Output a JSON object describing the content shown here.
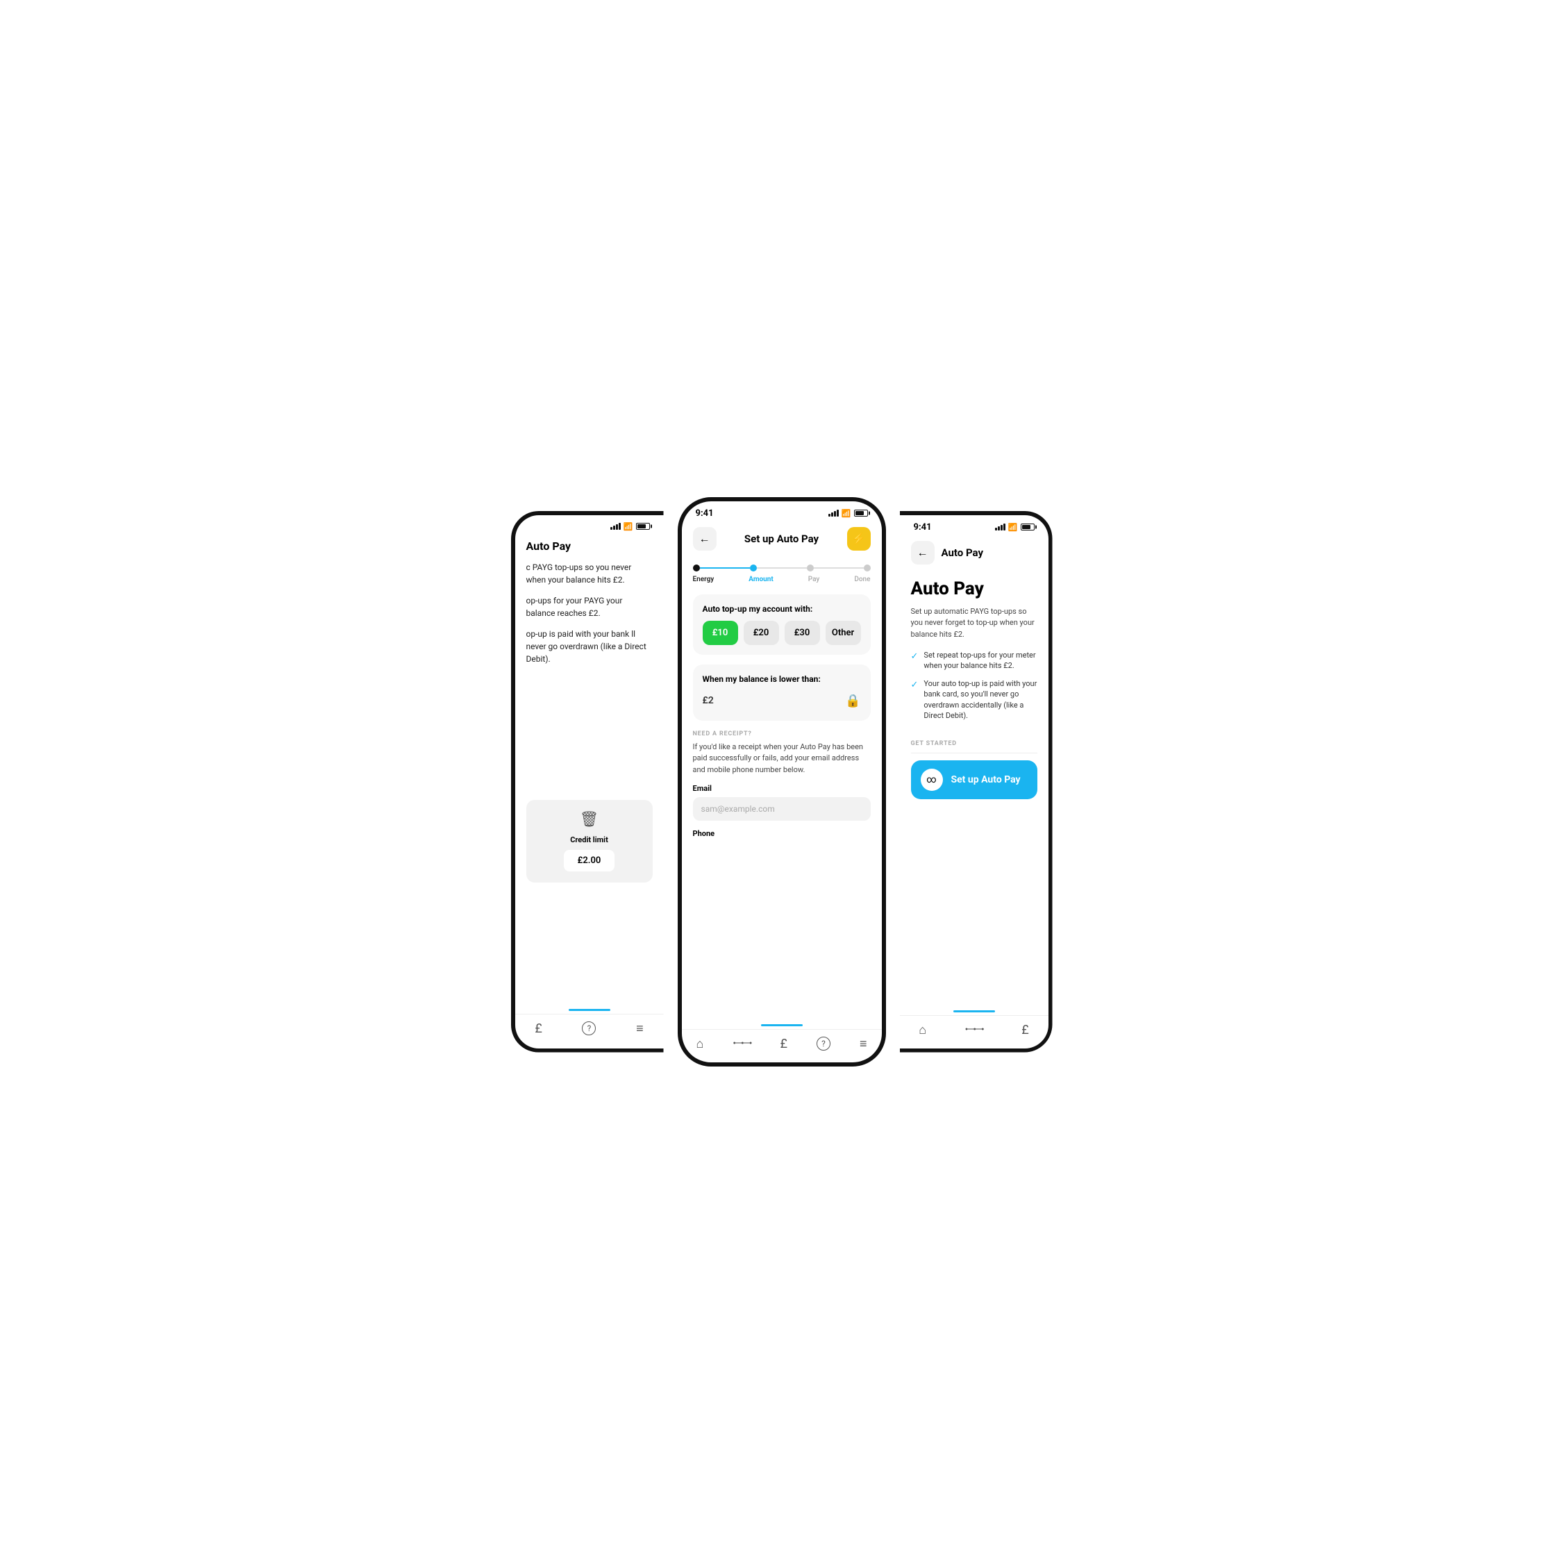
{
  "left_phone": {
    "header_title": "Auto Pay",
    "body_text_1": "c PAYG top-ups so you never when your balance hits £2.",
    "body_text_2": "op-ups for your PAYG your balance reaches £2.",
    "body_text_3": "op-up is paid with your bank ll never go overdrawn (like a Direct Debit).",
    "delete_icon": "🗑",
    "credit_limit_label": "Credit limit",
    "credit_limit_value": "£2.00",
    "nav_items": [
      {
        "icon": "£",
        "label": ""
      },
      {
        "icon": "?",
        "label": ""
      },
      {
        "icon": "≡",
        "label": ""
      }
    ]
  },
  "center_phone": {
    "status_time": "9:41",
    "header_title": "Set up Auto Pay",
    "back_icon": "←",
    "lightning_icon": "⚡",
    "steps": [
      {
        "label": "Energy",
        "state": "done"
      },
      {
        "label": "Amount",
        "state": "active"
      },
      {
        "label": "Pay",
        "state": "inactive"
      },
      {
        "label": "Done",
        "state": "inactive"
      }
    ],
    "amount_section": {
      "title": "Auto top-up my account with:",
      "options": [
        {
          "value": "£10",
          "selected": true
        },
        {
          "value": "£20",
          "selected": false
        },
        {
          "value": "£30",
          "selected": false
        },
        {
          "value": "Other",
          "selected": false
        }
      ]
    },
    "balance_section": {
      "title": "When my balance is lower than:",
      "value": "£2",
      "lock_icon": "🔒"
    },
    "receipt_section": {
      "label": "NEED A RECEIPT?",
      "text": "If you'd like a receipt when your Auto Pay has been paid successfully or fails, add your email address and mobile phone number below.",
      "email_label": "Email",
      "email_placeholder": "sam@example.com",
      "phone_label": "Phone"
    },
    "nav_items": [
      {
        "icon": "🏠",
        "label": ""
      },
      {
        "icon": "⋯",
        "label": ""
      },
      {
        "icon": "£",
        "label": ""
      },
      {
        "icon": "?",
        "label": ""
      },
      {
        "icon": "≡",
        "label": ""
      }
    ]
  },
  "right_phone": {
    "status_time": "9:41",
    "header_title": "Auto Pay",
    "back_icon": "←",
    "main_title": "Auto Pay",
    "description": "Set up automatic PAYG top-ups so you never forget to top-up when your balance hits £2.",
    "bullets": [
      "Set repeat top-ups for your meter when your balance hits £2.",
      "Your auto top-up is paid with your bank card, so you'll never go overdrawn accidentally (like a Direct Debit)."
    ],
    "get_started_label": "GET STARTED",
    "setup_btn_label": "Set up Auto Pay",
    "setup_icon": "∞",
    "nav_items": [
      {
        "icon": "🏠"
      },
      {
        "icon": "⋯"
      },
      {
        "icon": "£"
      }
    ]
  },
  "colors": {
    "accent_blue": "#1ab4f0",
    "accent_green": "#22cc44",
    "accent_yellow": "#f5c518",
    "text_primary": "#111111",
    "text_secondary": "#555555",
    "bg_card": "#f7f7f7",
    "bg_input": "#f2f2f2"
  }
}
